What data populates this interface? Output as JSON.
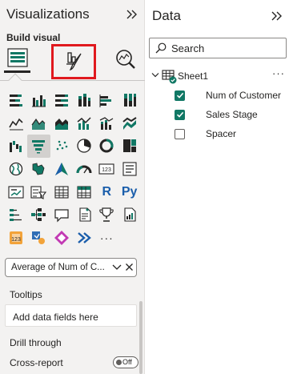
{
  "visualizations": {
    "title": "Visualizations",
    "build_label": "Build visual",
    "field_well": {
      "value": "Average of Num of C..."
    },
    "sections": {
      "tooltips": "Tooltips",
      "add_fields": "Add data fields here",
      "drill_through": "Drill through",
      "cross_report": "Cross-report",
      "toggle": "Off"
    },
    "icons": [
      [
        "stacked-bar-chart-icon",
        "clustered-bar-chart-icon",
        "hundred-percent-bar-icon",
        "stacked-column-chart-icon",
        "clustered-column-chart-icon",
        "hundred-percent-column-icon"
      ],
      [
        "line-chart-icon",
        "area-chart-icon",
        "stacked-area-chart-icon",
        "line-clustered-column-icon",
        "line-stacked-column-icon",
        "ribbon-chart-icon"
      ],
      [
        "waterfall-chart-icon",
        "funnel-chart-icon",
        "scatter-chart-icon",
        "pie-chart-icon",
        "donut-chart-icon",
        "treemap-icon"
      ],
      [
        "map-icon",
        "filled-map-icon",
        "azure-map-icon",
        "gauge-icon",
        "card-icon",
        "multi-row-card-icon"
      ],
      [
        "kpi-icon",
        "slicer-icon",
        "table-icon",
        "matrix-icon",
        "r-visual-icon",
        "python-visual-icon"
      ],
      [
        "key-influencers-icon",
        "decomposition-tree-icon",
        "qa-icon",
        "smart-narrative-icon",
        "metrics-icon",
        "paginated-report-icon"
      ],
      [
        "power-apps-icon",
        "power-automate-icon",
        "diamond-visual-icon",
        "chevron-visual-icon",
        "more-visuals-icon"
      ]
    ],
    "r_label": "R",
    "py_label": "Py",
    "card_label": "123",
    "more_label": "···"
  },
  "data": {
    "title": "Data",
    "search_placeholder": "Search",
    "table": "Sheet1",
    "more": "···",
    "fields": [
      {
        "label": "Num of Customer",
        "checked": true
      },
      {
        "label": "Sales Stage",
        "checked": true
      },
      {
        "label": "Spacer",
        "checked": false
      }
    ]
  },
  "colors": {
    "accent": "#117865",
    "highlight": "#e0191e",
    "pane": "#f3f2f1"
  }
}
